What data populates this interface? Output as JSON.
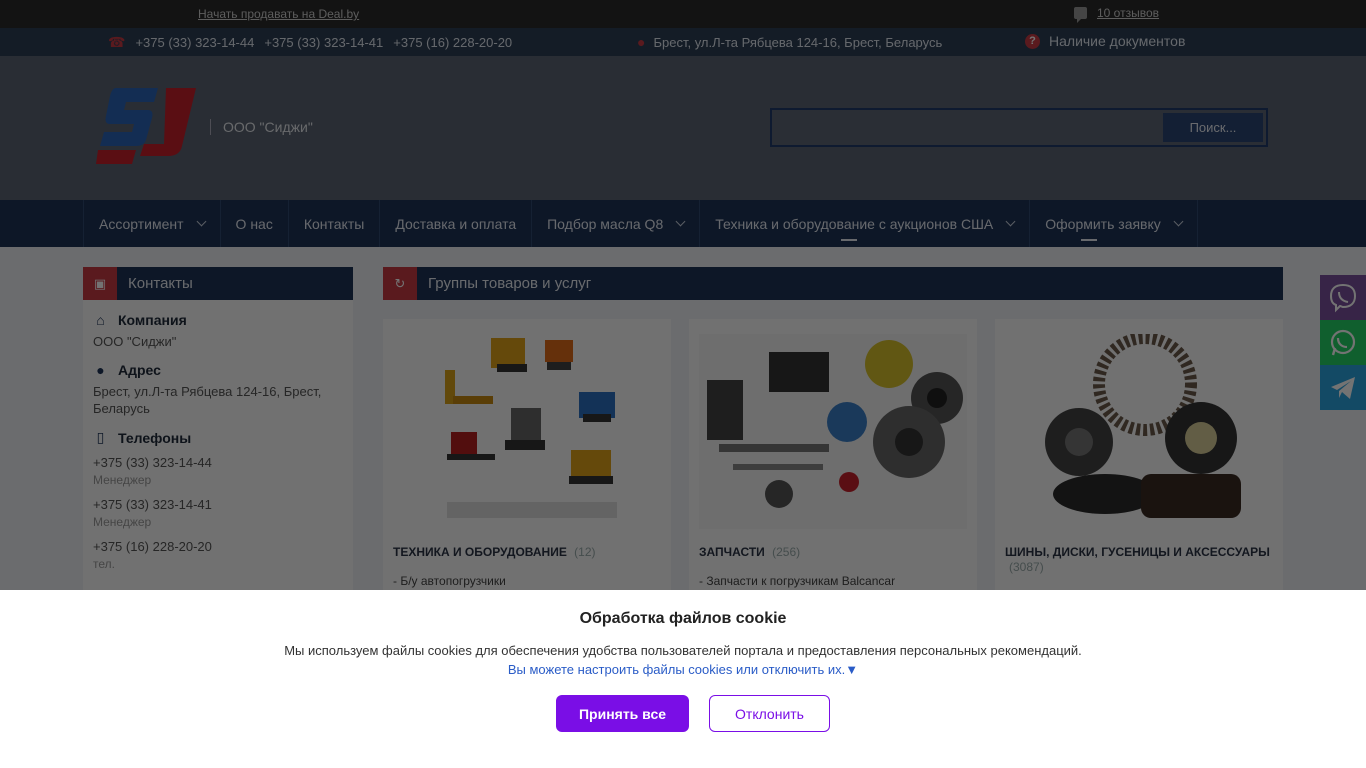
{
  "topbar": {
    "sell_link": "Начать продавать на Deal.by",
    "reviews": "10 отзывов"
  },
  "infobar": {
    "phones": [
      "+375 (33) 323-14-44",
      "+375 (33) 323-14-41",
      "+375 (16) 228-20-20"
    ],
    "address": "Брест, ул.Л-та Рябцева 124-16, Брест, Беларусь",
    "documents": "Наличие документов"
  },
  "header": {
    "company": "ООО \"Сиджи\"",
    "search_button": "Поиск...",
    "search_placeholder": ""
  },
  "nav": {
    "items": [
      {
        "label": "Ассортимент"
      },
      {
        "label": "О нас"
      },
      {
        "label": "Контакты"
      },
      {
        "label": "Доставка и оплата"
      },
      {
        "label": "Подбор масла Q8"
      },
      {
        "label": "Техника и оборудование с аукционов США"
      },
      {
        "label": "Оформить заявку"
      }
    ]
  },
  "sidebar": {
    "title": "Контакты",
    "company_label": "Компания",
    "company_value": "ООО \"Сиджи\"",
    "address_label": "Адрес",
    "address_value": "Брест, ул.Л-та Рябцева 124-16, Брест, Беларусь",
    "phones_label": "Телефоны",
    "phones": [
      {
        "number": "+375 (33) 323-14-44",
        "note": "Менеджер"
      },
      {
        "number": "+375 (33) 323-14-41",
        "note": "Менеджер"
      },
      {
        "number": "+375 (16) 228-20-20",
        "note": "тел."
      }
    ]
  },
  "groups": {
    "title": "Группы товаров и услуг",
    "cards": [
      {
        "title": "ТЕХНИКА И ОБОРУДОВАНИЕ",
        "count": "(12)",
        "sub": "-   Б/у автопогрузчики"
      },
      {
        "title": "ЗАПЧАСТИ",
        "count": "(256)",
        "sub": "-   Запчасти к погрузчикам Balcancar"
      },
      {
        "title": "ШИНЫ, ДИСКИ, ГУСЕНИЦЫ И АКСЕССУАРЫ",
        "count": "(3087)",
        "sub": ""
      }
    ]
  },
  "cookie": {
    "title": "Обработка файлов cookie",
    "message": "Мы используем файлы cookies для обеспечения удобства пользователей портала и предоставления персональных рекомендаций.",
    "settings_link": "Вы можете настроить файлы cookies или отключить их.▼",
    "accept": "Принять все",
    "decline": "Отклонить"
  },
  "colors": {
    "nav_bg": "#1d3357",
    "accent_red": "#c83a44",
    "cookie_purple": "#7a0ee6",
    "viber": "#7b519d",
    "whatsapp": "#25d366",
    "telegram": "#2ca5e0"
  }
}
